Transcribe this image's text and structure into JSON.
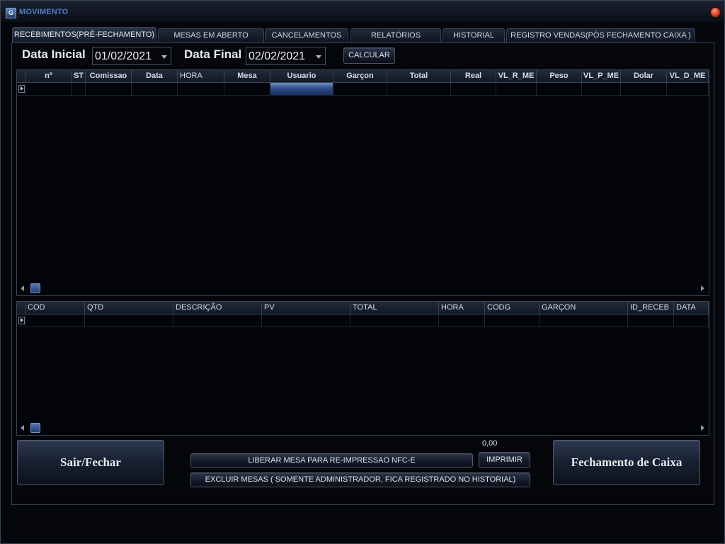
{
  "window": {
    "title": "MOVIMENTO",
    "icon_letter": "G"
  },
  "tabs": [
    "RECEBIMENTOS(PRÉ-FECHAMENTO)",
    "MESAS EM ABERTO",
    "CANCELAMENTOS",
    "RELATÓRIOS",
    "HISTORIAL",
    "REGISTRO VENDAS(PÓS FECHAMENTO CAIXA   )"
  ],
  "filters": {
    "start_label": "Data Inicial",
    "start_value": "01/02/2021",
    "end_label": "Data Final",
    "end_value": "02/02/2021",
    "calc_label": "CALCULAR"
  },
  "grid_top": {
    "columns": [
      "nº",
      "ST",
      "Comissao",
      "Data",
      "HORA",
      "Mesa",
      "Usuario",
      "Garçon",
      "Total",
      "Real",
      "VL_R_ME",
      "Peso",
      "VL_P_ME",
      "Dolar",
      "VL_D_ME"
    ]
  },
  "grid_bottom": {
    "columns": [
      "COD",
      "QTD",
      "DESCRIÇÃO",
      "PV",
      "TOTAL",
      "HORA",
      "CODG",
      "GARÇON",
      "ID_RECEB",
      "DATA"
    ]
  },
  "footer": {
    "exit_label": "Sair/Fechar",
    "release_label": "LIBERAR MESA PARA RE-IMPRESSAO NFC-E",
    "delete_label": "EXCLUIR MESAS ( SOMENTE ADMINISTRADOR, FICA REGISTRADO NO HISTORIAL)",
    "print_label": "IMPRIMIR",
    "total_value": "0,00",
    "close_cash_label": "Fechamento de Caixa"
  }
}
